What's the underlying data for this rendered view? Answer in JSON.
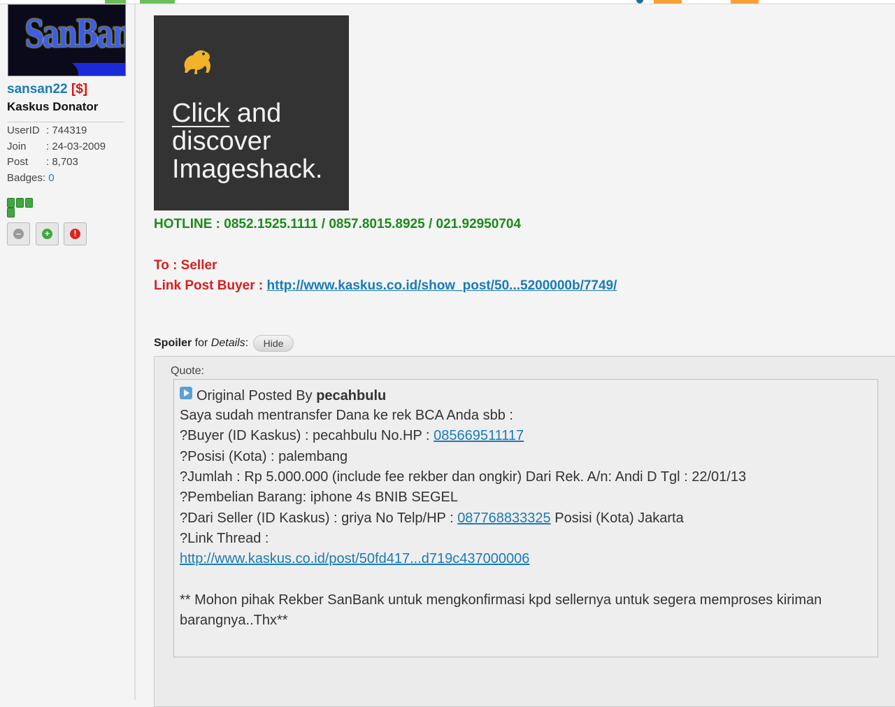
{
  "user": {
    "avatar_text": "SanBank",
    "username": "sansan22",
    "tag": "[$]",
    "title": "Kaskus Donator",
    "info": [
      {
        "key": "UserID",
        "value": ": 744319"
      },
      {
        "key": "Join",
        "value": ": 24-03-2009"
      },
      {
        "key": "Post",
        "value": ": 8,703"
      },
      {
        "key": "Badges",
        "value": ": ",
        "link": "0"
      }
    ],
    "reputation_bars": 4
  },
  "ad": {
    "line1_underlined": "Click",
    "line1_rest": " and",
    "line2": "discover",
    "line3": "Imageshack."
  },
  "post": {
    "hotline": "HOTLINE : 0852.1525.1111 / 0857.8015.8925 / 021.92950704",
    "to": "To : Seller",
    "link_label": "Link Post Buyer : ",
    "link_url": "http://www.kaskus.co.id/show_post/50...5200000b/7749/",
    "spoiler_strong": "Spoiler",
    "spoiler_for": " for ",
    "spoiler_details": "Details",
    "spoiler_colon": ":",
    "hide_label": "Hide"
  },
  "quote": {
    "label": "Quote:",
    "posted_by_prefix": "Original Posted By ",
    "posted_by_user": "pecahbulu",
    "line1": "Saya sudah mentransfer Dana ke rek BCA Anda sbb :",
    "line2_prefix": "?Buyer (ID Kaskus) : pecahbulu No.HP : ",
    "line2_phone": "085669511117",
    "line3": "?Posisi (Kota) : palembang",
    "line4": "?Jumlah : Rp 5.000.000 (include fee rekber dan ongkir) Dari Rek. A/n: Andi D Tgl : 22/01/13",
    "line5": "?Pembelian Barang: iphone 4s BNIB SEGEL",
    "line6_prefix": "?Dari Seller (ID Kaskus) : griya No Telp/HP : ",
    "line6_phone": "087768833325",
    "line6_suffix": " Posisi (Kota) Jakarta",
    "line7": "?Link Thread :",
    "thread_url": "http://www.kaskus.co.id/post/50fd417...d719c437000006",
    "note1": "** Mohon pihak Rekber SanBank untuk mengkonfirmasi kpd sellernya untuk segera memproses kiriman",
    "note2": "barangnya..Thx**"
  }
}
